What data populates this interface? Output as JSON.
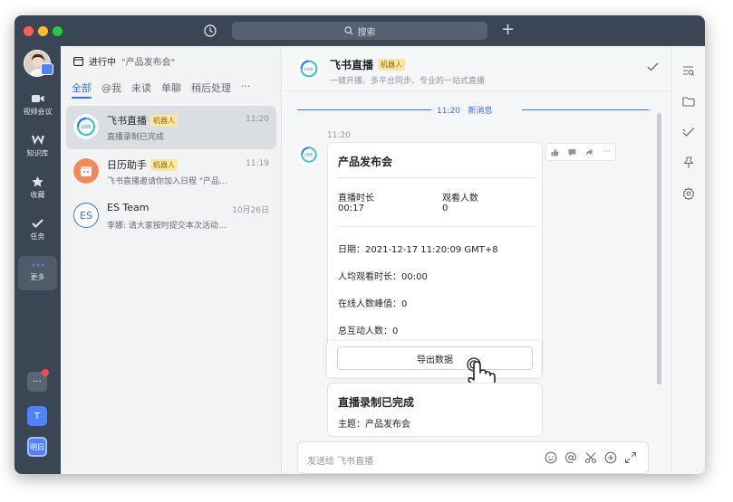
{
  "titlebar": {
    "search_placeholder": "搜索"
  },
  "rail": {
    "items": [
      {
        "label": "视频会议",
        "icon": "video-icon"
      },
      {
        "label": "知识库",
        "icon": "wiki-icon"
      },
      {
        "label": "收藏",
        "icon": "star-icon"
      },
      {
        "label": "任务",
        "icon": "task-icon"
      },
      {
        "label": "更多",
        "icon": "more-icon"
      }
    ],
    "avatar_letter": "T",
    "today_label": "明日"
  },
  "list": {
    "header_status": "进行中",
    "header_topic": "\"产品发布会\"",
    "tabs": [
      "全部",
      "@我",
      "未读",
      "单聊",
      "稍后处理",
      "···"
    ],
    "chats": [
      {
        "name": "飞书直播",
        "tag": "机器人",
        "time": "11:20",
        "preview": "直播录制已完成"
      },
      {
        "name": "日历助手",
        "tag": "机器人",
        "time": "11:19",
        "preview": "飞书直播邀请你加入日程 \"产品..."
      },
      {
        "name": "ES Team",
        "tag": "",
        "time": "10月26日",
        "preview": "李娜: 请大家按时提交本次活动...",
        "avatar_text": "ES"
      }
    ]
  },
  "chat": {
    "title": "飞书直播",
    "tag": "机器人",
    "subtitle": "一键开播、多平台同步、专业的一站式直播",
    "divider_time": "11:20",
    "divider_label": "新消息",
    "msg_time": "11:20",
    "card": {
      "title": "产品发布会",
      "stat1_label": "直播时长",
      "stat1_value": "00:17",
      "stat2_label": "观看人数",
      "stat2_value": "0",
      "date": "日期：2021-12-17   11:20:09   GMT+8",
      "avg_watch": "人均观看时长：00:00",
      "peak_online": "在线人数峰值：0",
      "interactions": "总互动人数：0",
      "export_label": "导出数据"
    },
    "card2": {
      "title": "直播录制已完成",
      "line": "主题：产品发布会"
    },
    "input_placeholder": "发送给 飞书直播"
  }
}
